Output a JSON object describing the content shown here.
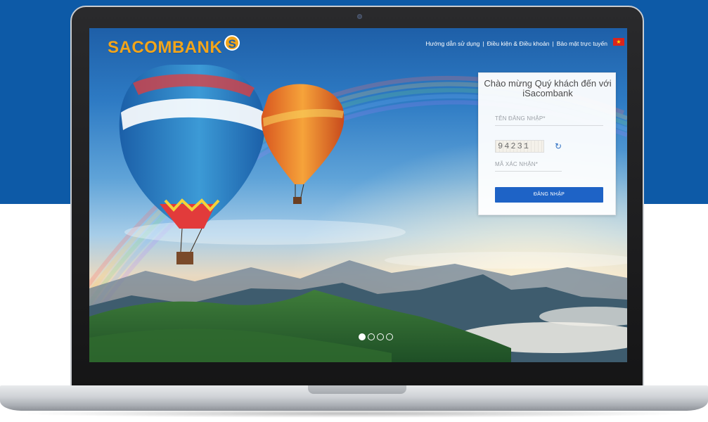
{
  "brand": {
    "name": "SACOMBANK",
    "mark": "S",
    "primary_color": "#0d5aa7",
    "accent_color": "#f2a51a"
  },
  "header": {
    "links": [
      "Hướng dẫn sử dụng",
      "Điều kiện & Điều khoản",
      "Bảo mật trực tuyến"
    ],
    "separator": "|",
    "language_flag": "vietnam-flag-icon",
    "flag_star": "★"
  },
  "login": {
    "welcome_text": "Chào mừng Quý khách đến với iSacombank",
    "username_placeholder": "TÊN ĐĂNG NHẬP*",
    "captcha_text": "94231",
    "captcha_placeholder": "MÃ XÁC NHẬN*",
    "refresh_icon": "refresh-icon",
    "login_button": "ĐĂNG NHẬP"
  },
  "carousel": {
    "slide_count": 4,
    "active_index": 0
  }
}
